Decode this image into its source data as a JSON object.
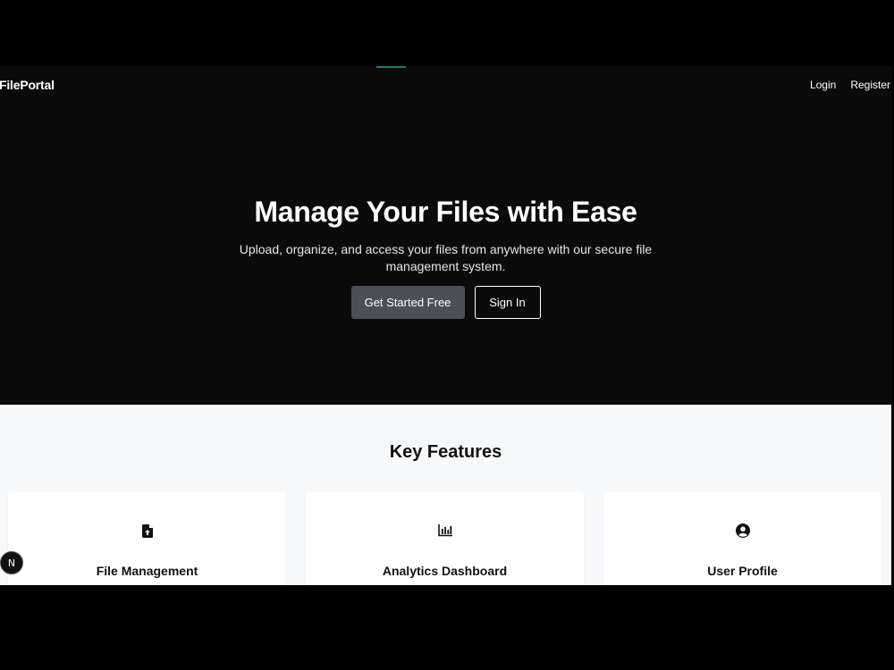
{
  "nav": {
    "brand": "FilePortal",
    "links": [
      "Login",
      "Register"
    ]
  },
  "hero": {
    "title": "Manage Your Files with Ease",
    "subtitle": "Upload, organize, and access your files from anywhere with our secure file management system.",
    "primary_cta": "Get Started Free",
    "secondary_cta": "Sign In"
  },
  "features": {
    "title": "Key Features",
    "cards": [
      {
        "title": "File Management",
        "icon": "file-upload-icon"
      },
      {
        "title": "Analytics Dashboard",
        "icon": "bar-chart-icon"
      },
      {
        "title": "User Profile",
        "icon": "user-circle-icon"
      }
    ]
  },
  "badge": {
    "label": "N",
    "icon": "nextjs-icon"
  },
  "colors": {
    "hero_bg": "#0b0b0b",
    "primary_button": "#4a5059",
    "features_bg": "#f7f8fa",
    "progress_accent": "#1f7a7a"
  }
}
